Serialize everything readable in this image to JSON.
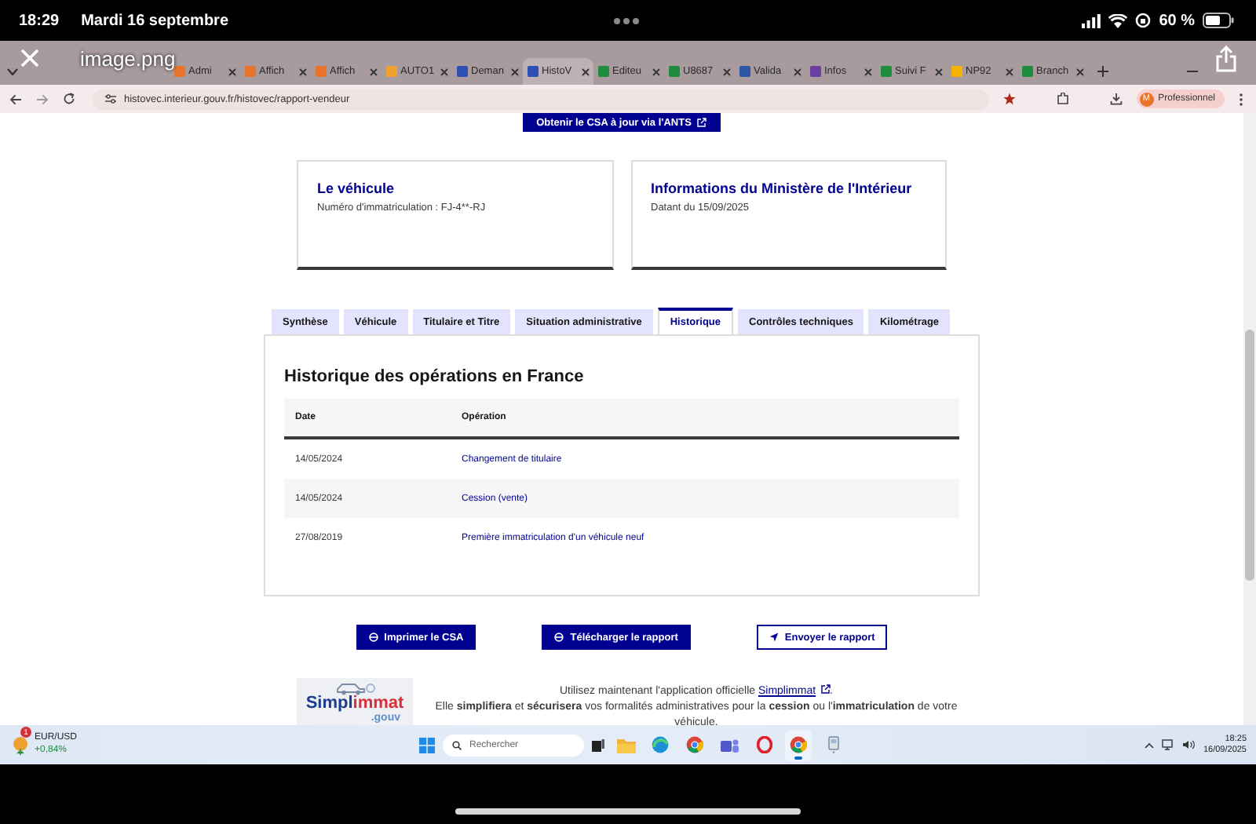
{
  "status_bar": {
    "time": "18:29",
    "date": "Mardi 16 septembre",
    "battery": "60 %"
  },
  "viewer": {
    "title": "image.png"
  },
  "browser": {
    "tabs": [
      {
        "label": "Admi",
        "color": "#e8742a",
        "selected": false
      },
      {
        "label": "Affich",
        "color": "#e8742a",
        "selected": false
      },
      {
        "label": "Affich",
        "color": "#e8742a",
        "selected": false
      },
      {
        "label": "AUTO1",
        "color": "#f0a030",
        "selected": false
      },
      {
        "label": "Deman",
        "color": "#2b4fb3",
        "selected": false
      },
      {
        "label": "HistoV",
        "color": "#2b4fb3",
        "selected": true
      },
      {
        "label": "Editeu",
        "color": "#1e8e3e",
        "selected": false
      },
      {
        "label": "U8687",
        "color": "#1e8e3e",
        "selected": false
      },
      {
        "label": "Valida",
        "color": "#3056a8",
        "selected": false
      },
      {
        "label": "Infos",
        "color": "#6b3fa0",
        "selected": false
      },
      {
        "label": "Suivi F",
        "color": "#1e8e3e",
        "selected": false
      },
      {
        "label": "NP92",
        "color": "#f4b400",
        "selected": false
      },
      {
        "label": "Branch",
        "color": "#1e8e3e",
        "selected": false
      }
    ],
    "address": "histovec.interieur.gouv.fr/histovec/rapport-vendeur",
    "profile": {
      "initial": "M",
      "label": "Professionnel"
    }
  },
  "page": {
    "top_button": "Obtenir le CSA à jour via l'ANTS",
    "cards": [
      {
        "title": "Le véhicule",
        "text": "Numéro d'immatriculation : FJ-4**-RJ"
      },
      {
        "title": "Informations du Ministère de l'Intérieur",
        "text": "Datant du 15/09/2025"
      }
    ],
    "tabs": [
      {
        "label": "Synthèse",
        "selected": false
      },
      {
        "label": "Véhicule",
        "selected": false
      },
      {
        "label": "Titulaire et Titre",
        "selected": false
      },
      {
        "label": "Situation administrative",
        "selected": false
      },
      {
        "label": "Historique",
        "selected": true
      },
      {
        "label": "Contrôles techniques",
        "selected": false
      },
      {
        "label": "Kilométrage",
        "selected": false
      }
    ],
    "panel": {
      "title": "Historique des opérations en France",
      "columns": [
        "Date",
        "Opération"
      ],
      "rows": [
        {
          "date": "14/05/2024",
          "operation": "Changement de titulaire"
        },
        {
          "date": "14/05/2024",
          "operation": "Cession (vente)"
        },
        {
          "date": "27/08/2019",
          "operation": "Première immatriculation d'un véhicule neuf"
        }
      ]
    },
    "actions": [
      {
        "label": "Imprimer le CSA",
        "kind": "primary"
      },
      {
        "label": "Télécharger le rapport",
        "kind": "primary"
      },
      {
        "label": "Envoyer le rapport",
        "kind": "secondary"
      }
    ],
    "promo": {
      "logo": {
        "part_1": "Simpl",
        "part_2": "immat",
        "suffix": ".gouv"
      },
      "lead": "Utilisez maintenant l'application officielle",
      "link": "Simplimmat",
      "after_link": ".",
      "body": "Elle **simplifiera** et **sécurisera** vos formalités administratives pour la **cession** ou l'**immatriculation** de votre véhicule."
    }
  },
  "taskbar": {
    "ticker": {
      "badge": "1",
      "label": "EUR/USD",
      "change": "+0,84%"
    },
    "search": {
      "placeholder": "Rechercher"
    },
    "apps": [
      {
        "kind": "folder",
        "selected": false
      },
      {
        "kind": "edge",
        "selected": false
      },
      {
        "kind": "chrome",
        "selected": false
      },
      {
        "kind": "teams",
        "selected": false
      },
      {
        "kind": "opera",
        "selected": false
      },
      {
        "kind": "chrome",
        "selected": true
      },
      {
        "kind": "device",
        "selected": false
      }
    ],
    "clock": {
      "time": "18:25",
      "date": "16/09/2025"
    }
  }
}
